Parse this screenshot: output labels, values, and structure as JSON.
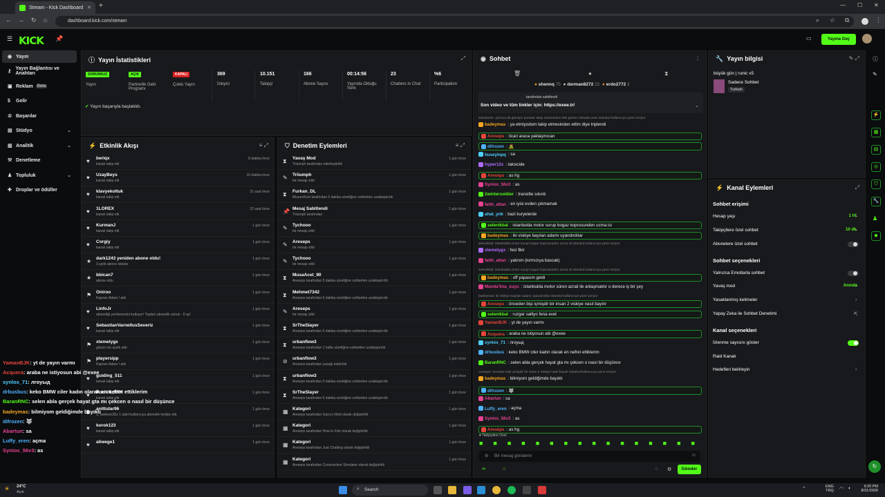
{
  "browser": {
    "tab_title": "Stream - Kick Dashboard",
    "url": "dashboard.kick.com/stream"
  },
  "header": {
    "go_live": "Yayına Geç"
  },
  "sidebar": {
    "items": [
      {
        "label": "Yayın"
      },
      {
        "label": "Yayın Bağlantısı ve Anahtarı"
      },
      {
        "label": "Reklam",
        "badge": "Beta"
      },
      {
        "label": "Gelir"
      },
      {
        "label": "Başarılar"
      },
      {
        "label": "Stüdyo"
      },
      {
        "label": "Analitik"
      },
      {
        "label": "Denetleme"
      },
      {
        "label": "Topluluk"
      },
      {
        "label": "Droplar ve ödüller"
      }
    ]
  },
  "stats": {
    "title": "Yayın İstatistikleri",
    "items": [
      {
        "value": "SORUNSUZ",
        "label": "Yayın"
      },
      {
        "value": "AÇIK",
        "label": "Partnerlik Gelir Programı"
      },
      {
        "value": "KAPALI",
        "label": "Çoklu Yayın"
      },
      {
        "value": "369",
        "label": "İzleyici"
      },
      {
        "value": "10.151",
        "label": "Takipçi"
      },
      {
        "value": "166",
        "label": "Abone Sayısı"
      },
      {
        "value": "00:14:56",
        "label": "Yayında Olduğu Süre"
      },
      {
        "value": "23",
        "label": "Chatters in Chat"
      },
      {
        "value": "%6",
        "label": "Participation"
      }
    ],
    "success": "Yayın başarıyla başlatıldı."
  },
  "activity": {
    "title": "Etkinlik Akışı",
    "rows": [
      {
        "name": "beriqx",
        "sub": "kanalı takip etti",
        "time": "8 dakika önce"
      },
      {
        "name": "UzayBeys",
        "sub": "kanalı takip etti",
        "time": "10 dakika önce"
      },
      {
        "name": "klavyekoltuk",
        "sub": "kanalı takip etti",
        "time": "21 saat önce"
      },
      {
        "name": "1LOREX",
        "sub": "kanalı takip etti",
        "time": "22 saat önce"
      },
      {
        "name": "KurmanJ",
        "sub": "kanalı takip etti",
        "time": "1 gün önce"
      },
      {
        "name": "Corgiy",
        "sub": "kanalı takip etti",
        "time": "1 gün önce"
      },
      {
        "name": "dark1243 yeniden abone oldu!",
        "sub": "3 aylık abone oldular",
        "time": "1 gün önce"
      },
      {
        "name": "bbican7",
        "sub": "abone oldu",
        "time": "1 gün önce"
      },
      {
        "name": "Oniroo",
        "sub": "Kapoze Adam I aldı",
        "time": "1 gün önce"
      },
      {
        "name": "LinfoJr",
        "sub": "aboneliği yenilemesini kutluyor! Toplam abonelik süresi - 8 ay!",
        "time": "1 gün önce"
      },
      {
        "name": "SebastianVarnellusSeveriz",
        "sub": "kanalı takip etti",
        "time": "1 gün önce"
      },
      {
        "name": "xtemelygx",
        "sub": "gözün mü açıldı aldı",
        "time": "1 gün önce"
      },
      {
        "name": "playersipp",
        "sub": "Kapoze Adam I aldı",
        "time": "1 gün önce"
      },
      {
        "name": "guiding_511",
        "sub": "kanalı takip etti",
        "time": "1 gün önce"
      },
      {
        "name": "Pozitiff_RTX",
        "sub": "kanalı takip etti",
        "time": "1 gün önce"
      },
      {
        "name": "anittutar96",
        "sub": "1, fawkess35z 1 adet kullanıcıya abonelik hediye etti.",
        "time": "1 gün önce"
      },
      {
        "name": "korok123",
        "sub": "kanalı takip etti",
        "time": "1 gün önce"
      },
      {
        "name": "aliwege1",
        "sub": "",
        "time": "1 gün önce"
      }
    ]
  },
  "moderation": {
    "title": "Denetim Eylemleri",
    "rows": [
      {
        "name": "Yavaş Mod",
        "sub": "Triiumph tarafından etkinleştirildi",
        "time": "1 gün önce"
      },
      {
        "name": "Triiumph",
        "sub": "bir mesajı sildi",
        "time": "1 gün önce"
      },
      {
        "name": "Furkan_DL",
        "sub": "MusumKezi tarafından 5 dakika süreliğine sohbetten uzaklaştırıldı",
        "time": "1 gün önce"
      },
      {
        "name": "Mesaj Sabitlendi",
        "sub": "Triiumph tarafından",
        "time": "1 gün önce"
      },
      {
        "name": "Tychooo",
        "sub": "bir mesajı sildi",
        "time": "1 gün önce"
      },
      {
        "name": "Areseps",
        "sub": "bir mesajı sildi",
        "time": "1 gün önce"
      },
      {
        "name": "Tychooo",
        "sub": "bir mesajı sildi",
        "time": "1 gün önce"
      },
      {
        "name": "MusaAcet_90",
        "sub": "Areseps tarafından 5 dakika süreliğine sohbetten uzaklaştırıldı",
        "time": "1 gün önce"
      },
      {
        "name": "Mehmet7342",
        "sub": "Areseps tarafından 5 dakika süreliğine sohbetten uzaklaştırıldı",
        "time": "1 gün önce"
      },
      {
        "name": "Areseps",
        "sub": "bir mesajı sildi",
        "time": "1 gün önce"
      },
      {
        "name": "SrTheSlayer",
        "sub": "Areseps tarafından 5 dakika süreliğine sohbetten uzaklaştırıldı",
        "time": "1 gün önce"
      },
      {
        "name": "urbanflow3",
        "sub": "Areseps tarafından 1 hafta süreliğine sohbetten uzaklaştırıldı",
        "time": "1 gün önce"
      },
      {
        "name": "urbanflow3",
        "sub": "Areseps tarafından yasağı kaldırıldı",
        "time": "1 gün önce"
      },
      {
        "name": "urbanflow3",
        "sub": "Areseps tarafından 5 dakika süreliğine sohbetten uzaklaştırıldı",
        "time": "1 gün önce"
      },
      {
        "name": "SrTheSlayer",
        "sub": "Areseps tarafından 5 dakika süreliğine sohbetten uzaklaştırıldı",
        "time": "1 gün önce"
      },
      {
        "name": "Kategori",
        "sub": "Areseps tarafından Garry's Mod olarak değiştirildi",
        "time": "1 gün önce"
      },
      {
        "name": "Kategori",
        "sub": "Areseps tarafından How to Fish olarak değiştirildi",
        "time": "1 gün önce"
      },
      {
        "name": "Kategori",
        "sub": "Areseps tarafından Just Chatting olarak değiştirildi",
        "time": "1 gün önce"
      },
      {
        "name": "Kategori",
        "sub": "Areseps tarafından Construction Simulator olarak değiştirildi",
        "time": "1 gün önce"
      }
    ]
  },
  "chat": {
    "title": "Sohbet",
    "top": [
      {
        "name": "shennq",
        "count": "75"
      },
      {
        "name": "derman8272",
        "count": "22"
      },
      {
        "name": "erdo2772",
        "count": "2"
      }
    ],
    "pinned_by": "tarafından sabitlendi",
    "pinned": "Son video ve tüm linkler için: https://exee.tr/",
    "messages": [
      {
        "sys": "istanbul31: çıkınca da gitmiyor puanlar takip etmesinden bile gitmez dahada artar istanbul kullanıcıya yanıt veriyor"
      },
      {
        "user": "badeymas",
        "color": "#f5a623",
        "text": "ya etmiyodum takip etmesinden ettim diye triplendi"
      },
      {
        "user": "Areseps",
        "color": "#e8453c",
        "text": "ticari araca yaklaşmıcan",
        "hl": true
      },
      {
        "user": "difrozen",
        "color": "#4fb3ff",
        "text": "🧟",
        "hl": true
      },
      {
        "user": "huseyinpq",
        "color": "#4fd0ff",
        "text": "sa"
      },
      {
        "user": "hyper12x",
        "color": "#b06cff",
        "text": "taksicide"
      },
      {
        "user": "Areseps",
        "color": "#e8453c",
        "text": "as hg",
        "hl": true
      },
      {
        "user": "Syniox_56v3",
        "color": "#e84393",
        "text": "as"
      },
      {
        "user": "2wintersoldier",
        "color": "#53fc18",
        "text": "transitte sıkıntı"
      },
      {
        "user": "fatih_altan",
        "color": "#e84393",
        "text": "en iyisi evden çıkmamak"
      },
      {
        "user": "ahat_ynk",
        "color": "#4fd0ff",
        "text": "bazi kuryelerde"
      },
      {
        "user": "selenikbal",
        "color": "#53fc18",
        "text": "istanbulda motor surup bogaz koprusunden ucma isi",
        "hl": true
      },
      {
        "user": "badeymas",
        "color": "#f5a623",
        "text": "iki viskiye bayılan adamı uyandırdılar",
        "hl": true
      },
      {
        "sys": "selenikbal: istanbulda motor surup bogaz koprusunden ucma isi istanbul kullanıcıya yanıt veriyor"
      },
      {
        "user": "xtemelygx",
        "color": "#b06cff",
        "text": "feci fikir"
      },
      {
        "user": "fatih_altan",
        "color": "#e84393",
        "text": "yatırım (kırmızıya bascak)"
      },
      {
        "sys": "selenikbal: istanbulda motor surup bogaz koprusunden ucma isi istanbul kullanıcıya yanıt veriyor"
      },
      {
        "user": "badeymas",
        "color": "#f5a623",
        "text": "off yapasım geldi",
        "hl": true
      },
      {
        "user": "Manda'lina_suyu",
        "color": "#e84393",
        "text": "istanbulda motor süren azrail ile anlaşmaktır o derece iş bir şey"
      },
      {
        "sys": "badeymas: iki viskiye bayılan adamı uyandırdılar istanbul kullanıcıya yanıt veriyor"
      },
      {
        "user": "Areseps",
        "color": "#e8453c",
        "text": "önceden bişi içmişdir bir insan 2 viskiye nasıl bayılır",
        "hl": true
      },
      {
        "user": "selenikbal",
        "color": "#53fc18",
        "text": "ruzgar salliyo fena evet",
        "hl": true
      },
      {
        "user": "YamanBJK",
        "color": "#e8453c",
        "text": "yt de yayın varmı"
      },
      {
        "user": "Acquera",
        "color": "#e8453c",
        "text": "araba ne istiyosun abi @exee",
        "hl": true
      },
      {
        "user": "synlox_71",
        "color": "#4fd0ff",
        "text": "лгоуыд"
      },
      {
        "user": "drbusbus",
        "color": "#4fb3ff",
        "text": "keko BMW ciler kadın olarak en nefret ettiklerim"
      },
      {
        "user": "BaranRNC",
        "color": "#53fc18",
        "text": "selen abla gerçek hayat gta mı çekcen o nasıl bir düşünce"
      },
      {
        "sys": "Areseps: önceden bişi içmişdir bir insan 2 viskiye nasıl bayılır istanbul kullanıcıya yanıt veriyor"
      },
      {
        "user": "badeymas",
        "color": "#f5a623",
        "text": "bilmiyom geldiğimde bayıktı"
      },
      {
        "user": "difrozen",
        "color": "#4fb3ff",
        "text": "🐺",
        "hl": true
      },
      {
        "user": "Abartun",
        "color": "#e84393",
        "text": "sa"
      },
      {
        "user": "Luffy_eren",
        "color": "#4fb3ff",
        "text": "açma"
      },
      {
        "user": "Syniox_56v3",
        "color": "#e84393",
        "text": "as"
      },
      {
        "user": "Areseps",
        "color": "#e8453c",
        "text": "as hg",
        "hl": true
      }
    ],
    "followers_only": "Takipçilere Özel",
    "input_placeholder": "Bir mesaj gönderin",
    "send": "Gönder"
  },
  "stream_info": {
    "title": "Yayın bilgisi",
    "stream_title": "büyük gün | runic v5",
    "category": "Sadece Sohbet",
    "language": "Turkish"
  },
  "channel_actions": {
    "title": "Kanal Eylemleri",
    "chat_access": "Sohbet erişimi",
    "account_age": {
      "label": "Hesap yaşı",
      "value": "1 hf."
    },
    "followers_chat": {
      "label": "Takipçilere özel sohbet",
      "value": "10 dk."
    },
    "subs_chat": {
      "label": "Abonelere özel sohbet"
    },
    "chat_options": "Sohbet seçenekleri",
    "emotes_only": {
      "label": "Yalnızca Emotlarla sohbet"
    },
    "slow_mode": {
      "label": "Yavaş mod",
      "value": "Anında"
    },
    "banned_words": {
      "label": "Yasaklanmış kelimeler"
    },
    "ai_mod": {
      "label": "Yapay Zeka ile Sohbet Denetimi"
    },
    "channel_options": "Kanal seçenekleri",
    "show_viewers": {
      "label": "İzlenme sayısını göster"
    },
    "raid": {
      "label": "Raid Kanalı"
    },
    "host": {
      "label": "Hedefleri belirleyin"
    }
  },
  "overlay_chat": [
    {
      "user": "YamanBJK",
      "color": "#e8453c",
      "text": "yt de yayın varmı"
    },
    {
      "user": "Acquera",
      "color": "#e8453c",
      "text": "araba ne istiyosun abi @exee"
    },
    {
      "user": "synlox_71",
      "color": "#4fd0ff",
      "text": "лгоуыд"
    },
    {
      "user": "drbusbus",
      "color": "#4fb3ff",
      "text": "keko BMW ciler kadın olarak en nefret ettiklerim"
    },
    {
      "user": "BaranRNC",
      "color": "#53fc18",
      "text": "selen abla gerçek hayat gta mı çekcen o nasıl bir düşünce"
    },
    {
      "user": "badeymas",
      "color": "#f5a623",
      "text": "bilmiyom geldiğimde bayıktı"
    },
    {
      "user": "difrozen",
      "color": "#4fb3ff",
      "text": "🐺"
    },
    {
      "user": "Abartun",
      "color": "#e84393",
      "text": "sa"
    },
    {
      "user": "Luffy_eren",
      "color": "#4fb3ff",
      "text": "açma"
    },
    {
      "user": "Syniox_56v3",
      "color": "#e84393",
      "text": "as"
    }
  ],
  "taskbar": {
    "weather_temp": "24°C",
    "weather_desc": "Açık",
    "search": "Search",
    "lang1": "ENG",
    "lang2": "TRQ",
    "time": "9:20 PM",
    "date": "8/31/2026"
  }
}
